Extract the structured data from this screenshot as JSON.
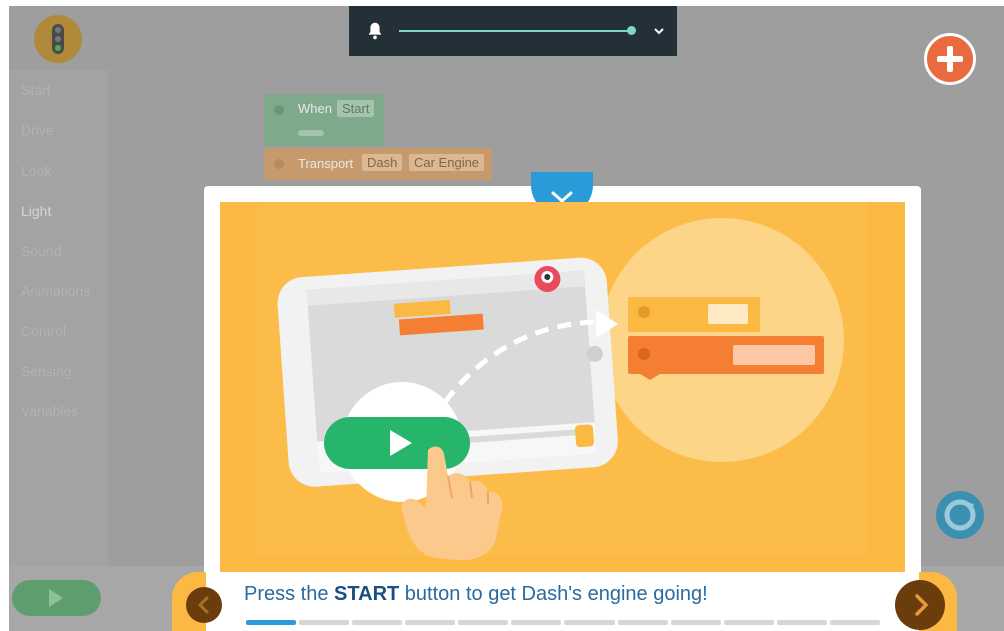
{
  "sidebar": {
    "categories": [
      "Start",
      "Drive",
      "Look",
      "Light",
      "Sound",
      "Animations",
      "Control",
      "Sensing",
      "Variables"
    ],
    "active_category": "Light"
  },
  "canvas": {
    "when_block": {
      "label": "When",
      "value": "Start"
    },
    "transport_block": {
      "label": "Transport",
      "robot": "Dash",
      "sound": "Car Engine"
    }
  },
  "volume": {
    "level_fraction": 1.0,
    "icon": "bell-icon"
  },
  "modal": {
    "caption_prefix": "Press the ",
    "caption_bold": "START",
    "caption_suffix": " button to get Dash's engine going!",
    "progress": {
      "total_steps": 12,
      "current_step": 1
    }
  },
  "colors": {
    "accent_blue": "#2b9ad8",
    "illustration_bg": "#fbb843",
    "start_green": "#27b56b",
    "block_orange": "#f47f32",
    "add_button": "#e86a3e",
    "nav_button": "#6b3d0d"
  }
}
